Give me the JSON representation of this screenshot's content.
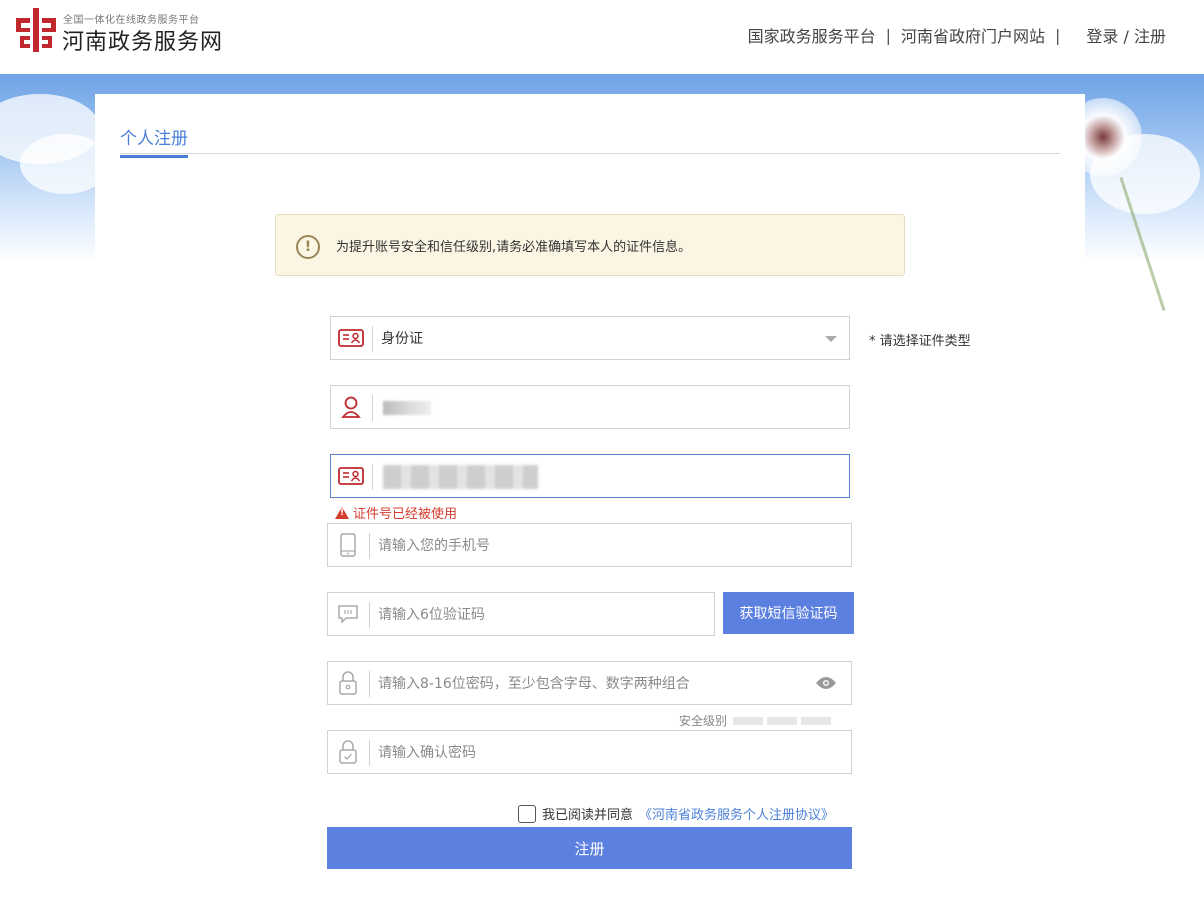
{
  "header": {
    "logo_sub": "全国一体化在线政务服务平台",
    "logo_title": "河南政务服务网",
    "nav": [
      "国家政务服务平台",
      "河南省政府门户网站",
      "登录 / 注册"
    ],
    "sep": "|"
  },
  "tab": {
    "title": "个人注册"
  },
  "notice": {
    "text": "为提升账号安全和信任级别,请务必准确填写本人的证件信息。"
  },
  "form": {
    "id_type": {
      "value": "身份证",
      "hint": "* 请选择证件类型"
    },
    "id_error": "证件号已经被使用",
    "phone": {
      "placeholder": "请输入您的手机号"
    },
    "sms": {
      "placeholder": "请输入6位验证码",
      "button": "获取短信验证码"
    },
    "password": {
      "placeholder": "请输入8-16位密码，至少包含字母、数字两种组合"
    },
    "strength_label": "安全级别",
    "confirm": {
      "placeholder": "请输入确认密码"
    },
    "agree_text": "我已阅读并同意",
    "agree_link": "《河南省政务服务个人注册协议》",
    "submit": "注册"
  },
  "colors": {
    "accent": "#5b80e0",
    "brand_red": "#c0282d",
    "error": "#d33b2c"
  }
}
